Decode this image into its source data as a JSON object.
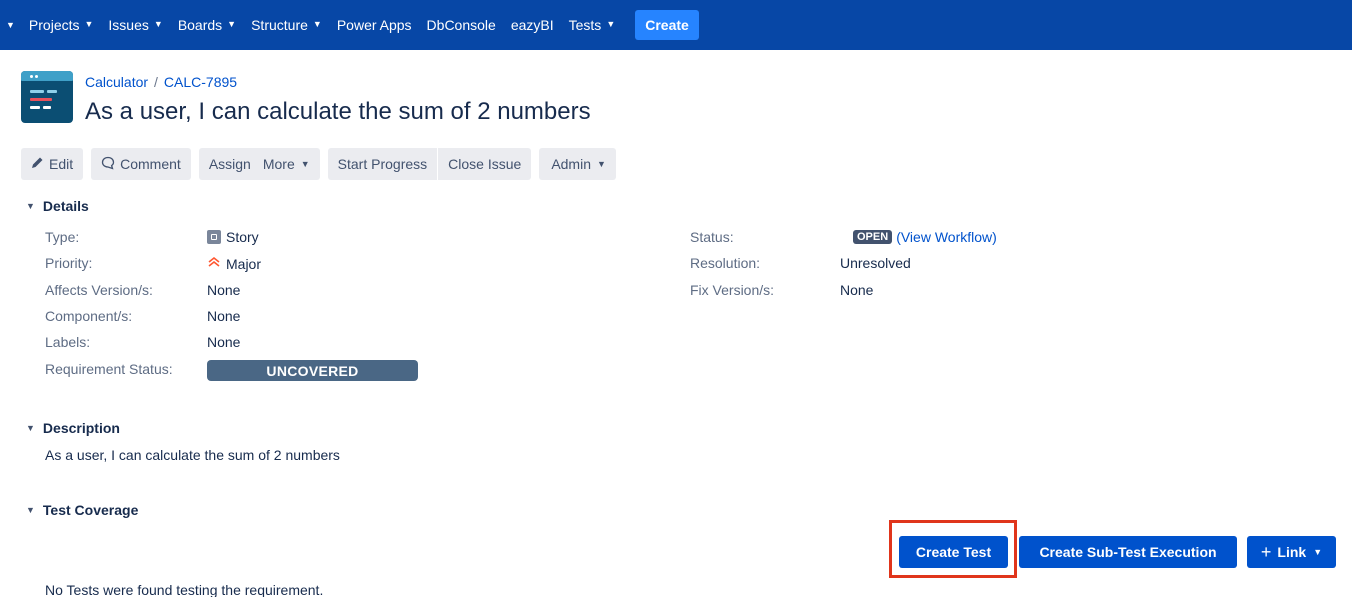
{
  "nav": {
    "items": [
      {
        "label": "Projects",
        "dropdown": true
      },
      {
        "label": "Issues",
        "dropdown": true
      },
      {
        "label": "Boards",
        "dropdown": true
      },
      {
        "label": "Structure",
        "dropdown": true
      },
      {
        "label": "Power Apps",
        "dropdown": false
      },
      {
        "label": "DbConsole",
        "dropdown": false
      },
      {
        "label": "eazyBI",
        "dropdown": false
      },
      {
        "label": "Tests",
        "dropdown": true
      }
    ],
    "create_label": "Create"
  },
  "breadcrumb": {
    "project": "Calculator",
    "separator": "/",
    "issue_key": "CALC-7895"
  },
  "issue": {
    "title": "As a user, I can calculate the sum of 2 numbers"
  },
  "toolbar": {
    "edit": "Edit",
    "comment": "Comment",
    "assign": "Assign",
    "more": "More",
    "start_progress": "Start Progress",
    "close_issue": "Close Issue",
    "admin": "Admin"
  },
  "details": {
    "heading": "Details",
    "type_label": "Type:",
    "type_value": "Story",
    "priority_label": "Priority:",
    "priority_value": "Major",
    "affects_label": "Affects Version/s:",
    "affects_value": "None",
    "component_label": "Component/s:",
    "component_value": "None",
    "labels_label": "Labels:",
    "labels_value": "None",
    "req_status_label": "Requirement Status:",
    "req_status_value": "UNCOVERED",
    "status_label": "Status:",
    "status_value": "OPEN",
    "view_workflow": "(View Workflow)",
    "resolution_label": "Resolution:",
    "resolution_value": "Unresolved",
    "fix_label": "Fix Version/s:",
    "fix_value": "None"
  },
  "description": {
    "heading": "Description",
    "text": "As a user, I can calculate the sum of 2 numbers"
  },
  "test_coverage": {
    "heading": "Test Coverage",
    "create_test": "Create Test",
    "create_sub_test_execution": "Create Sub-Test Execution",
    "link": "Link",
    "empty_message": "No Tests were found testing the requirement."
  },
  "colors": {
    "nav_bg": "#0747a6",
    "create_bg": "#2684ff",
    "primary": "#0052cc",
    "req_status_bg": "#4a6785",
    "highlight": "#e0351b"
  },
  "icons": [
    "chevron-down-icon",
    "pencil-icon",
    "comment-icon",
    "story-icon",
    "priority-major-icon",
    "plus-icon",
    "project-avatar-icon"
  ]
}
